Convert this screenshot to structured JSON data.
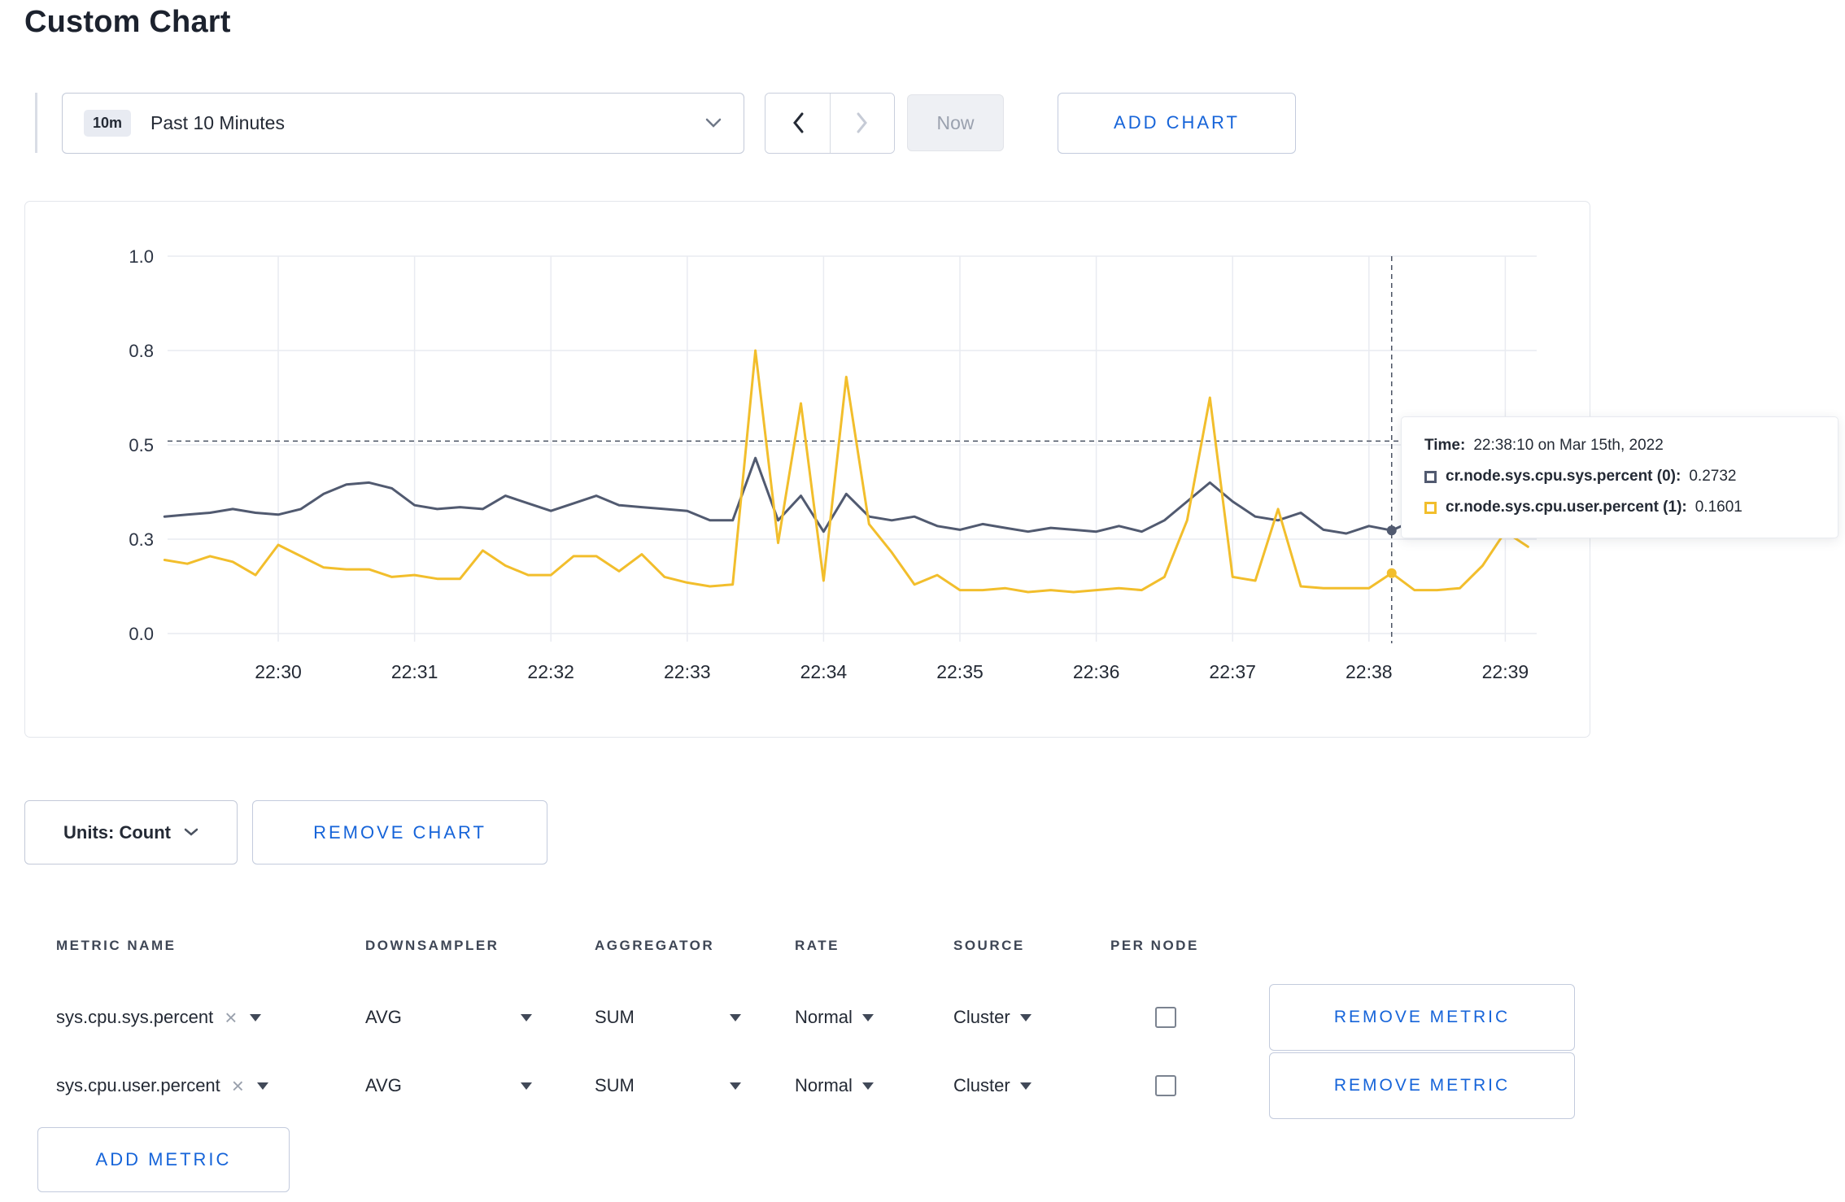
{
  "page": {
    "title": "Custom Chart"
  },
  "toolbar": {
    "time_badge": "10m",
    "time_range": "Past 10 Minutes",
    "now_label": "Now",
    "add_chart_label": "ADD CHART"
  },
  "chart_controls": {
    "units_label": "Units: Count",
    "remove_chart_label": "REMOVE CHART"
  },
  "tooltip": {
    "time_label": "Time:",
    "time_value": "22:38:10 on Mar 15th, 2022",
    "series": [
      {
        "label": "cr.node.sys.cpu.sys.percent (0):",
        "value": "0.2732",
        "color": "#515a70"
      },
      {
        "label": "cr.node.sys.cpu.user.percent (1):",
        "value": "0.1601",
        "color": "#f2be2c"
      }
    ]
  },
  "chart_data": {
    "type": "line",
    "title": "",
    "ylim": [
      0,
      1
    ],
    "grid": true,
    "x_ticks": [
      "22:30",
      "22:31",
      "22:32",
      "22:33",
      "22:34",
      "22:35",
      "22:36",
      "22:37",
      "22:38",
      "22:39"
    ],
    "y_ticks": [
      {
        "label": "1.0",
        "value": 1.0
      },
      {
        "label": "0.8",
        "value": 0.75
      },
      {
        "label": "0.5",
        "value": 0.5
      },
      {
        "label": "0.3",
        "value": 0.25
      },
      {
        "label": "0.0",
        "value": 0.0
      }
    ],
    "start_time": "22:29:10",
    "interval_seconds": 10,
    "crosshair": {
      "time": "22:38:10",
      "index": 54,
      "hline_value": 0.51
    },
    "series": [
      {
        "name": "cr.node.sys.cpu.sys.percent",
        "color": "#515a70",
        "values": [
          0.31,
          0.315,
          0.32,
          0.33,
          0.32,
          0.315,
          0.33,
          0.37,
          0.395,
          0.4,
          0.385,
          0.34,
          0.33,
          0.335,
          0.33,
          0.365,
          0.345,
          0.325,
          0.345,
          0.365,
          0.34,
          0.335,
          0.33,
          0.325,
          0.3,
          0.3,
          0.465,
          0.3,
          0.365,
          0.27,
          0.37,
          0.31,
          0.3,
          0.31,
          0.285,
          0.275,
          0.29,
          0.28,
          0.27,
          0.28,
          0.275,
          0.27,
          0.285,
          0.27,
          0.3,
          0.35,
          0.4,
          0.35,
          0.31,
          0.3,
          0.32,
          0.275,
          0.265,
          0.285,
          0.2732,
          0.3,
          0.32,
          0.3,
          0.295,
          0.305,
          0.27
        ]
      },
      {
        "name": "cr.node.sys.cpu.user.percent",
        "color": "#f2be2c",
        "values": [
          0.195,
          0.185,
          0.205,
          0.19,
          0.155,
          0.235,
          0.205,
          0.175,
          0.17,
          0.17,
          0.15,
          0.155,
          0.145,
          0.145,
          0.22,
          0.18,
          0.155,
          0.155,
          0.205,
          0.205,
          0.165,
          0.21,
          0.15,
          0.135,
          0.125,
          0.13,
          0.75,
          0.24,
          0.61,
          0.14,
          0.68,
          0.29,
          0.215,
          0.13,
          0.155,
          0.115,
          0.115,
          0.12,
          0.11,
          0.115,
          0.11,
          0.115,
          0.12,
          0.115,
          0.15,
          0.3,
          0.625,
          0.15,
          0.14,
          0.33,
          0.125,
          0.12,
          0.12,
          0.12,
          0.1601,
          0.115,
          0.115,
          0.12,
          0.18,
          0.27,
          0.23
        ]
      }
    ]
  },
  "metrics_table": {
    "headers": [
      "METRIC NAME",
      "DOWNSAMPLER",
      "AGGREGATOR",
      "RATE",
      "SOURCE",
      "PER NODE"
    ],
    "rows": [
      {
        "metric": "sys.cpu.sys.percent",
        "downsampler": "AVG",
        "aggregator": "SUM",
        "rate": "Normal",
        "source": "Cluster",
        "per_node": false,
        "remove_label": "REMOVE METRIC"
      },
      {
        "metric": "sys.cpu.user.percent",
        "downsampler": "AVG",
        "aggregator": "SUM",
        "rate": "Normal",
        "source": "Cluster",
        "per_node": false,
        "remove_label": "REMOVE METRIC"
      }
    ],
    "add_metric_label": "ADD METRIC"
  },
  "colors": {
    "accent_blue": "#1664d9",
    "series_dark": "#515a70",
    "series_yellow": "#f2be2c"
  }
}
